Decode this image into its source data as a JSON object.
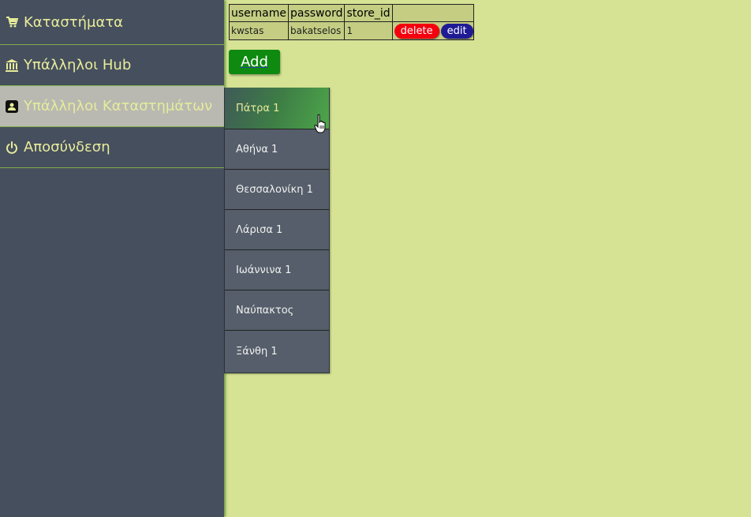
{
  "sidebar": {
    "items": [
      {
        "label": "Καταστήματα",
        "icon": "cart-icon"
      },
      {
        "label": "Υπάλληλοι Hub",
        "icon": "bank-icon"
      },
      {
        "label": "Υπάλληλοι Καταστημάτων",
        "icon": "employee-badge-icon"
      },
      {
        "label": "Αποσύνδεση",
        "icon": "power-icon"
      }
    ]
  },
  "table": {
    "headers": [
      "username",
      "password",
      "store_id",
      ""
    ],
    "rows": [
      {
        "username": "kwstas",
        "password": "bakatselos",
        "store_id": "1",
        "delete_label": "delete",
        "edit_label": "edit"
      }
    ]
  },
  "add_button": {
    "label": "Add"
  },
  "submenu": {
    "items": [
      "Πάτρα 1",
      "Αθήνα 1",
      "Θεσσαλονίκη 1",
      "Λάρισα 1",
      "Ιωάννινα 1",
      "Ναύπακτος",
      "Ξάνθη 1"
    ]
  },
  "colors": {
    "background": "#d6e394",
    "sidebar": "#464f5e",
    "delete": "#f4000e",
    "edit": "#1e1b95",
    "add": "#0f8a10"
  }
}
